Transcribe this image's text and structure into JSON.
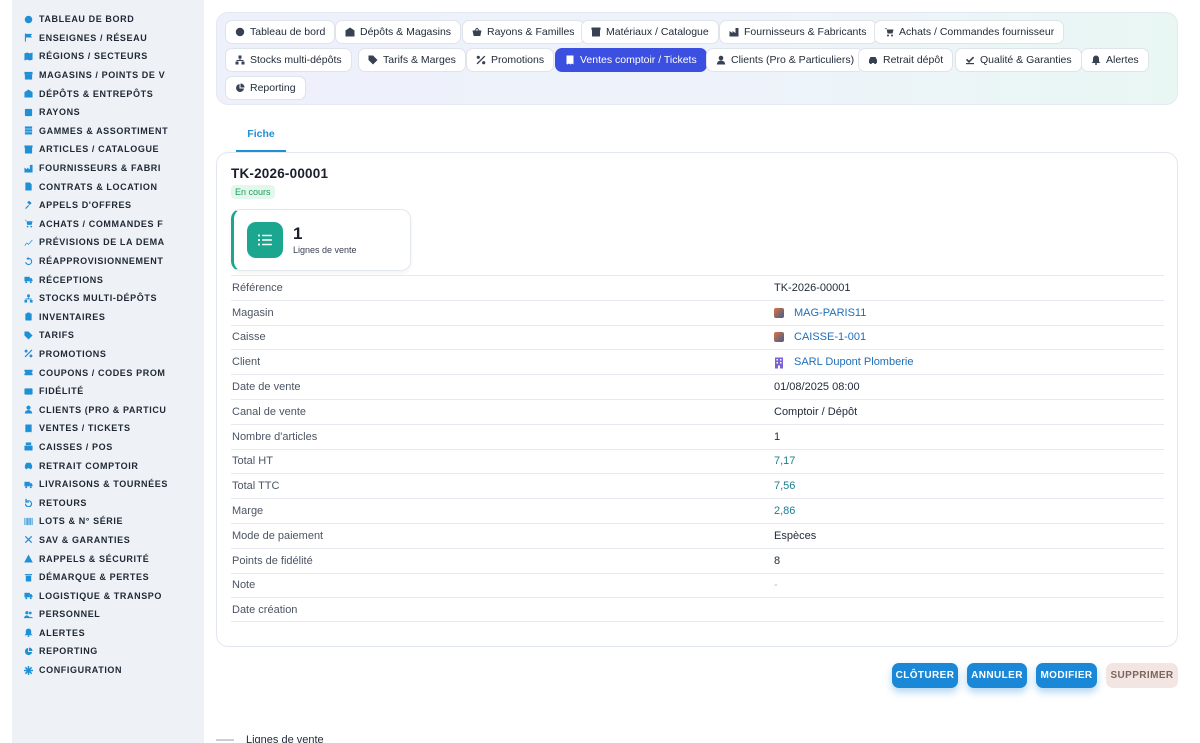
{
  "sidebar": {
    "items": [
      {
        "label": "TABLEAU DE BORD",
        "icon": "dashboard-icon"
      },
      {
        "label": "ENSEIGNES / RÉSEAU",
        "icon": "flag-icon"
      },
      {
        "label": "RÉGIONS / SECTEURS",
        "icon": "map-icon"
      },
      {
        "label": "MAGASINS / POINTS DE V",
        "icon": "store-icon"
      },
      {
        "label": "DÉPÔTS & ENTREPÔTS",
        "icon": "warehouse-icon"
      },
      {
        "label": "RAYONS",
        "icon": "shelf-icon"
      },
      {
        "label": "GAMMES & ASSORTIMENT",
        "icon": "layers-icon"
      },
      {
        "label": "ARTICLES / CATALOGUE",
        "icon": "box-icon"
      },
      {
        "label": "FOURNISSEURS & FABRI",
        "icon": "factory-icon"
      },
      {
        "label": "CONTRATS & LOCATION",
        "icon": "document-icon"
      },
      {
        "label": "APPELS D'OFFRES",
        "icon": "gavel-icon"
      },
      {
        "label": "ACHATS / COMMANDES F",
        "icon": "cart-icon"
      },
      {
        "label": "PRÉVISIONS DE LA DEMA",
        "icon": "chart-line-icon"
      },
      {
        "label": "RÉAPPROVISIONNEMENT",
        "icon": "refresh-icon"
      },
      {
        "label": "RÉCEPTIONS",
        "icon": "truck-in-icon"
      },
      {
        "label": "STOCKS MULTI-DÉPÔTS",
        "icon": "network-icon"
      },
      {
        "label": "INVENTAIRES",
        "icon": "clipboard-icon"
      },
      {
        "label": "TARIFS",
        "icon": "tag-icon"
      },
      {
        "label": "PROMOTIONS",
        "icon": "percent-icon"
      },
      {
        "label": "COUPONS / CODES PROM",
        "icon": "ticket-icon"
      },
      {
        "label": "FIDÉLITÉ",
        "icon": "id-card-icon"
      },
      {
        "label": "CLIENTS (PRO & PARTICU",
        "icon": "user-icon"
      },
      {
        "label": "VENTES / TICKETS",
        "icon": "receipt-icon"
      },
      {
        "label": "CAISSES / POS",
        "icon": "register-icon"
      },
      {
        "label": "RETRAIT COMPTOIR",
        "icon": "car-icon"
      },
      {
        "label": "LIVRAISONS & TOURNÉES",
        "icon": "truck-icon"
      },
      {
        "label": "RETOURS",
        "icon": "undo-icon"
      },
      {
        "label": "LOTS & N° SÉRIE",
        "icon": "barcode-icon"
      },
      {
        "label": "SAV & GARANTIES",
        "icon": "tools-icon"
      },
      {
        "label": "RAPPELS & SÉCURITÉ",
        "icon": "warning-icon"
      },
      {
        "label": "DÉMARQUE & PERTES",
        "icon": "trash-icon"
      },
      {
        "label": "LOGISTIQUE & TRANSPO",
        "icon": "shipping-icon"
      },
      {
        "label": "PERSONNEL",
        "icon": "users-icon"
      },
      {
        "label": "ALERTES",
        "icon": "bell-icon"
      },
      {
        "label": "REPORTING",
        "icon": "pie-chart-icon"
      },
      {
        "label": "CONFIGURATION",
        "icon": "gear-icon"
      }
    ]
  },
  "nav": {
    "pills": [
      {
        "label": "Tableau de bord",
        "icon": "dashboard-icon",
        "active": false
      },
      {
        "label": "Dépôts & Magasins",
        "icon": "warehouse-icon",
        "active": false
      },
      {
        "label": "Rayons & Familles",
        "icon": "basket-icon",
        "active": false
      },
      {
        "label": "Matériaux / Catalogue",
        "icon": "box-icon",
        "active": false
      },
      {
        "label": "Fournisseurs & Fabricants",
        "icon": "factory-icon",
        "active": false
      },
      {
        "label": "Achats / Commandes fournisseur",
        "icon": "cart-icon",
        "active": false
      },
      {
        "label": "Stocks multi-dépôts",
        "icon": "network-icon",
        "active": false
      },
      {
        "label": "Tarifs & Marges",
        "icon": "tag-icon",
        "active": false
      },
      {
        "label": "Promotions",
        "icon": "percent-icon",
        "active": false
      },
      {
        "label": "Ventes comptoir / Tickets",
        "icon": "receipt-icon",
        "active": true
      },
      {
        "label": "Clients (Pro & Particuliers)",
        "icon": "user-icon",
        "active": false
      },
      {
        "label": "Retrait dépôt",
        "icon": "car-icon",
        "active": false
      },
      {
        "label": "Qualité & Garanties",
        "icon": "check-badge-icon",
        "active": false
      },
      {
        "label": "Alertes",
        "icon": "bell-icon",
        "active": false
      },
      {
        "label": "Reporting",
        "icon": "pie-chart-icon",
        "active": false
      }
    ]
  },
  "tabs": {
    "fiche": "Fiche"
  },
  "record": {
    "title": "TK-2026-00001",
    "status": "En cours",
    "stat": {
      "value": "1",
      "label": "Lignes de vente"
    },
    "fields": [
      {
        "label": "Référence",
        "value": "TK-2026-00001",
        "style": ""
      },
      {
        "label": "Magasin",
        "value": "MAG-PARIS11",
        "style": "link",
        "icon": "store"
      },
      {
        "label": "Caisse",
        "value": "CAISSE-1-001",
        "style": "link",
        "icon": "store"
      },
      {
        "label": "Client",
        "value": "SARL Dupont Plomberie",
        "style": "link",
        "icon": "building"
      },
      {
        "label": "Date de vente",
        "value": "01/08/2025 08:00",
        "style": ""
      },
      {
        "label": "Canal de vente",
        "value": "Comptoir / Dépôt",
        "style": ""
      },
      {
        "label": "Nombre d'articles",
        "value": "1",
        "style": ""
      },
      {
        "label": "Total HT",
        "value": "7,17",
        "style": "teal"
      },
      {
        "label": "Total TTC",
        "value": "7,56",
        "style": "teal"
      },
      {
        "label": "Marge",
        "value": "2,86",
        "style": "teal"
      },
      {
        "label": "Mode de paiement",
        "value": "Espèces",
        "style": ""
      },
      {
        "label": "Points de fidélité",
        "value": "8",
        "style": ""
      },
      {
        "label": "Note",
        "value": "-",
        "style": "muted"
      },
      {
        "label": "Date création",
        "value": "",
        "style": ""
      }
    ]
  },
  "actions": {
    "close": "CLÔTURER",
    "cancel": "ANNULER",
    "edit": "MODIFIER",
    "delete": "SUPPRIMER"
  },
  "section": {
    "lines_heading": "Lignes de vente"
  },
  "colors": {
    "accent": "#1a88d6",
    "active_tab": "#3b4fe0",
    "teal": "#1aa68f",
    "status_green": "#19a05a"
  }
}
